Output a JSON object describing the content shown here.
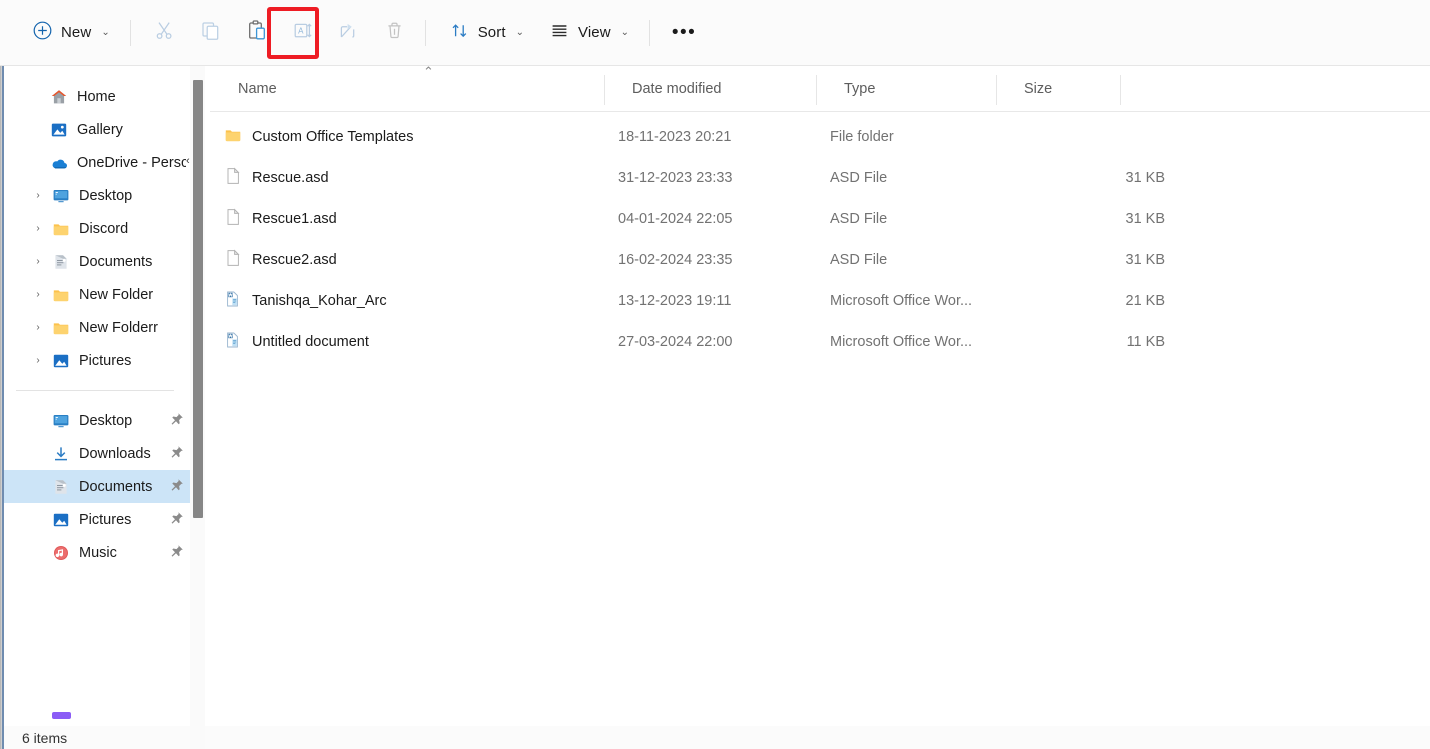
{
  "toolbar": {
    "new_button": {
      "label": "New",
      "icon": "plus-circle-icon",
      "chevron": "⌄"
    },
    "icon_buttons": [
      {
        "name": "cut-button",
        "icon": "scissors-icon",
        "tooltip": "Cut"
      },
      {
        "name": "copy-button",
        "icon": "copy-icon",
        "tooltip": "Copy"
      },
      {
        "name": "paste-button",
        "icon": "clipboard-paste-icon",
        "tooltip": "Paste",
        "highlighted": true
      },
      {
        "name": "rename-button",
        "icon": "rename-icon",
        "tooltip": "Rename"
      },
      {
        "name": "share-button",
        "icon": "share-icon",
        "tooltip": "Share"
      },
      {
        "name": "delete-button",
        "icon": "trash-icon",
        "tooltip": "Delete"
      }
    ],
    "sort_button": {
      "label": "Sort",
      "icon": "sort-arrows-icon",
      "chevron": "⌄"
    },
    "view_button": {
      "label": "View",
      "icon": "hamburger-lines-icon",
      "chevron": "⌄"
    },
    "more_button": {
      "label": "•••",
      "icon": "see-more-icon"
    },
    "highlight_color": "#ee1c24"
  },
  "sidebar": {
    "collapse_chevron": "‹",
    "items": [
      {
        "label": "Home",
        "icon": "home-icon",
        "indent": 0,
        "expander": "",
        "pinned": false,
        "selected": false
      },
      {
        "label": "Gallery",
        "icon": "gallery-icon",
        "indent": 0,
        "expander": "",
        "pinned": false,
        "selected": false
      },
      {
        "label": "OneDrive - Persc",
        "icon": "onedrive-icon",
        "indent": 0,
        "expander": "⌄",
        "pinned": false,
        "selected": false
      },
      {
        "label": "Desktop",
        "icon": "desktop-icon",
        "indent": 1,
        "expander": "›",
        "pinned": false,
        "selected": false
      },
      {
        "label": "Discord",
        "icon": "folder-icon",
        "indent": 1,
        "expander": "›",
        "pinned": false,
        "selected": false
      },
      {
        "label": "Documents",
        "icon": "documents-icon",
        "indent": 1,
        "expander": "›",
        "pinned": false,
        "selected": false
      },
      {
        "label": "New Folder",
        "icon": "folder-icon",
        "indent": 1,
        "expander": "›",
        "pinned": false,
        "selected": false
      },
      {
        "label": "New Folderr",
        "icon": "folder-icon",
        "indent": 1,
        "expander": "›",
        "pinned": false,
        "selected": false
      },
      {
        "label": "Pictures",
        "icon": "pictures-icon",
        "indent": 1,
        "expander": "›",
        "pinned": false,
        "selected": false
      }
    ],
    "quick_access": [
      {
        "label": "Desktop",
        "icon": "desktop-icon",
        "pinned": true,
        "selected": false
      },
      {
        "label": "Downloads",
        "icon": "downloads-icon",
        "pinned": true,
        "selected": false
      },
      {
        "label": "Documents",
        "icon": "documents-icon",
        "pinned": true,
        "selected": true
      },
      {
        "label": "Pictures",
        "icon": "pictures-icon",
        "pinned": true,
        "selected": false
      },
      {
        "label": "Music",
        "icon": "music-icon",
        "pinned": true,
        "selected": false
      }
    ],
    "selected_highlight_color": "#cce4f7",
    "scrollbar_thumb_color": "#868686"
  },
  "file_list": {
    "columns": [
      {
        "label": "Name",
        "sorted": "ascending",
        "sort_glyph": "⌃"
      },
      {
        "label": "Date modified",
        "sorted": "none",
        "sort_glyph": ""
      },
      {
        "label": "Type",
        "sorted": "none",
        "sort_glyph": ""
      },
      {
        "label": "Size",
        "sorted": "none",
        "sort_glyph": ""
      }
    ],
    "rows": [
      {
        "name": "Custom Office Templates",
        "date": "18-11-2023 20:21",
        "type": "File folder",
        "size": "",
        "icon": "folder-icon"
      },
      {
        "name": "Rescue.asd",
        "date": "31-12-2023 23:33",
        "type": "ASD File",
        "size": "31 KB",
        "icon": "generic-file-icon"
      },
      {
        "name": "Rescue1.asd",
        "date": "04-01-2024 22:05",
        "type": "ASD File",
        "size": "31 KB",
        "icon": "generic-file-icon"
      },
      {
        "name": "Rescue2.asd",
        "date": "16-02-2024 23:35",
        "type": "ASD File",
        "size": "31 KB",
        "icon": "generic-file-icon"
      },
      {
        "name": "Tanishqa_Kohar_Arc",
        "date": "13-12-2023 19:11",
        "type": "Microsoft Office Wor...",
        "size": "21 KB",
        "icon": "word-document-icon"
      },
      {
        "name": "Untitled document",
        "date": "27-03-2024 22:00",
        "type": "Microsoft Office Wor...",
        "size": "11 KB",
        "icon": "word-document-icon"
      }
    ]
  },
  "status": {
    "item_count": "6 items"
  }
}
